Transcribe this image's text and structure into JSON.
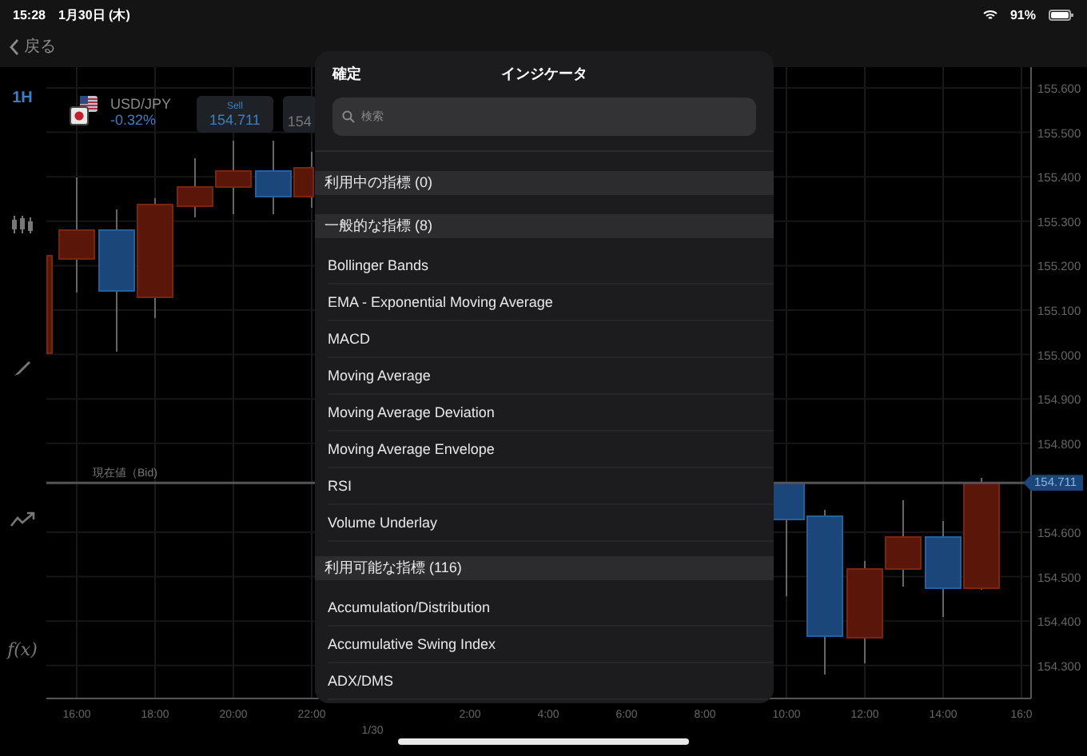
{
  "status_bar": {
    "time": "15:28",
    "date": "1月30日 (木)",
    "battery": "91%"
  },
  "nav": {
    "back": "戻る"
  },
  "chart": {
    "timeframe": "1H",
    "symbol": "USD/JPY",
    "change": "-0.32%",
    "sell": {
      "label": "Sell",
      "price": "154.711"
    },
    "buy": {
      "price": "154"
    },
    "current_price_label": "現在値（Bid)",
    "current_price": "154.711",
    "function_button": "f(x)",
    "y_labels": [
      "155.600",
      "155.500",
      "155.400",
      "155.300",
      "155.200",
      "155.100",
      "155.000",
      "154.900",
      "154.800",
      "154.600",
      "154.500",
      "154.400",
      "154.300"
    ],
    "x_labels": [
      "16:00",
      "18:00",
      "20:00",
      "22:00",
      "2:00",
      "4:00",
      "6:00",
      "8:00",
      "10:00",
      "12:00",
      "14:00",
      "16:0"
    ],
    "date_label": "1/30"
  },
  "indicator_panel": {
    "confirm": "確定",
    "title": "インジケータ",
    "search": {
      "placeholder": "検索"
    },
    "sections": [
      {
        "title": "利用中の指標 (0)"
      },
      {
        "title": "一般的な指標 (8)",
        "items": [
          "Bollinger Bands",
          "EMA - Exponential Moving Average",
          "MACD",
          "Moving Average",
          "Moving Average Deviation",
          "Moving Average Envelope",
          "RSI",
          "Volume Underlay"
        ]
      },
      {
        "title": "利用可能な指標 (116)",
        "items": [
          "Accumulation/Distribution",
          "Accumulative Swing Index",
          "ADX/DMS"
        ]
      }
    ]
  }
}
